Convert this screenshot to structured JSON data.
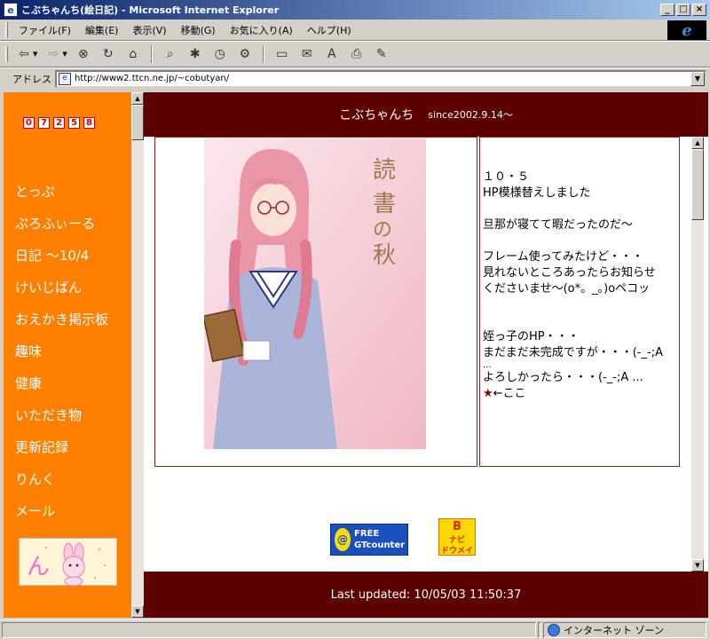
{
  "window": {
    "title": "こぶちゃんち(絵日記) - Microsoft Internet Explorer",
    "minimize": "_",
    "maximize": "□",
    "close": "×"
  },
  "menu": {
    "items": [
      "ファイル(F)",
      "編集(E)",
      "表示(V)",
      "移動(G)",
      "お気に入り(A)",
      "ヘルプ(H)"
    ]
  },
  "toolbar": {
    "icons": [
      "back-icon",
      "forward-icon",
      "stop-icon",
      "refresh-icon",
      "home-icon",
      "search-icon",
      "favorites-icon",
      "history-icon",
      "tools-icon",
      "fullscreen-icon",
      "mail-icon",
      "font-icon",
      "print-icon",
      "edit-icon"
    ]
  },
  "address": {
    "label": "アドレス",
    "url": "http://www2.ttcn.ne.jp/~cobutyan/"
  },
  "site": {
    "title": "こぶちゃんち",
    "since": "since2002.9.14～",
    "counter": [
      "0",
      "7",
      "2",
      "5",
      "8"
    ],
    "nav": [
      "とっぷ",
      "ぷろふぃーる",
      "日記 ～10/4",
      "けいじばん",
      "おえかき掲示板",
      "趣味",
      "健康",
      "いただき物",
      "更新記録",
      "りんく",
      "メール"
    ],
    "illustration_caption": [
      "読",
      "書",
      "の",
      "秋"
    ],
    "news": [
      "１０・５",
      "HP模様替えしました",
      "",
      "旦那が寝てて暇だったのだ～",
      "",
      "フレーム使ってみたけど・・・",
      "見れないところあったらお知らせ",
      "くださいませ～(o*。_。)oペコッ",
      "",
      "",
      "姪っ子のHP・・・",
      "まだまだ未完成ですが・・・(-_-;A",
      "...",
      "よろしかったら・・・(-_-;A ...",
      "←ここ"
    ],
    "star": "★",
    "gt_badge": [
      "FREE",
      "GTcounter"
    ],
    "b_badge": {
      "main": "B",
      "sub1": "ナビ",
      "sub2": "ドウメイ"
    },
    "last_updated": "Last updated: 10/05/03 11:50:37"
  },
  "status": {
    "zone": "インターネット ゾーン"
  },
  "colors": {
    "sidebar": "#ff8000",
    "header": "#5c0000"
  }
}
